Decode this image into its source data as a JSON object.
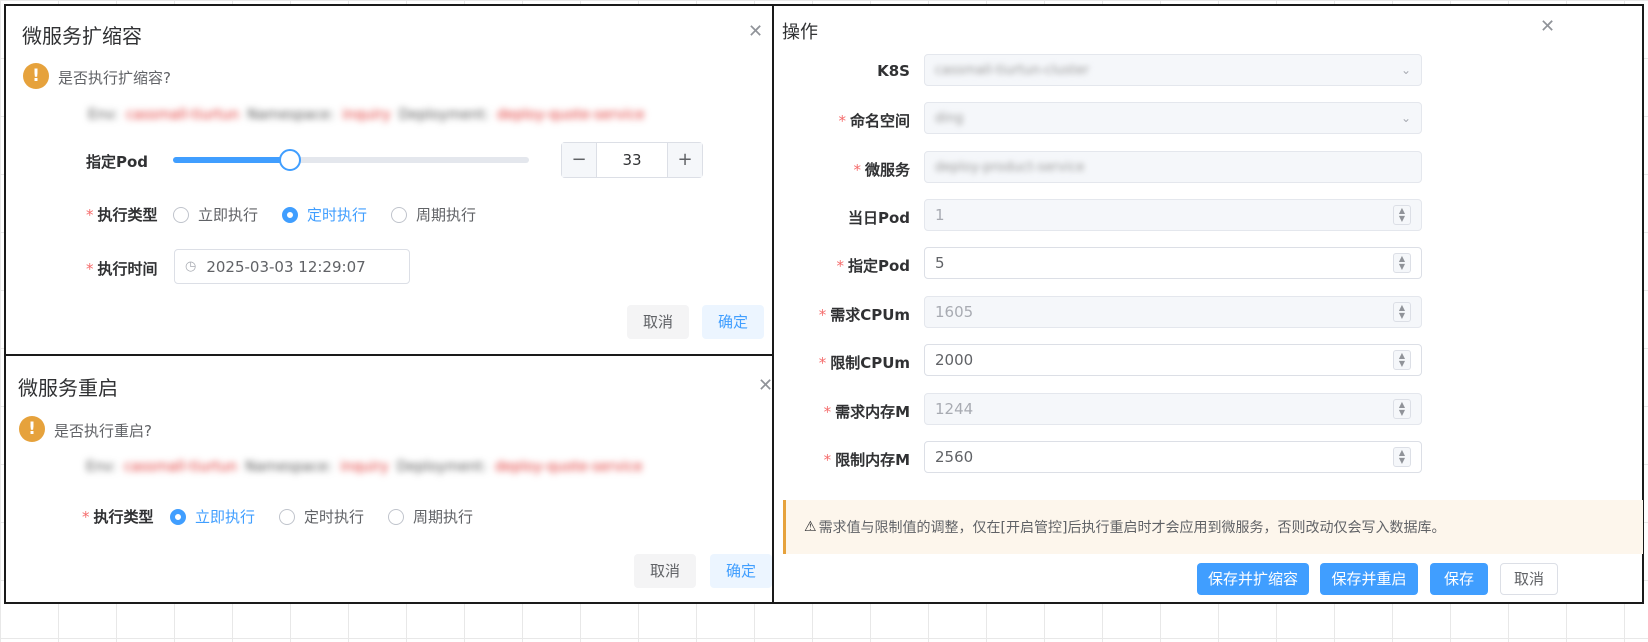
{
  "scale_dialog": {
    "title": "微服务扩缩容",
    "question": "是否执行扩缩容?",
    "info": [
      {
        "key": "Env:",
        "value": "cassmall-tiurtun"
      },
      {
        "key": "Namespace:",
        "value": "inquiry"
      },
      {
        "key": "Deployment:",
        "value": "deploy-quote-service"
      }
    ],
    "pod_label": "指定Pod",
    "pod_value": "33",
    "slider_fraction": 0.33,
    "exec_type_label": "执行类型",
    "exec_options": [
      "立即执行",
      "定时执行",
      "周期执行"
    ],
    "exec_selected": "定时执行",
    "exec_time_label": "执行时间",
    "exec_time_value": "2025-03-03 12:29:07",
    "cancel_label": "取消",
    "confirm_label": "确定"
  },
  "restart_dialog": {
    "title": "微服务重启",
    "question": "是否执行重启?",
    "info": [
      {
        "key": "Env:",
        "value": "cassmall-tiurtun"
      },
      {
        "key": "Namespace:",
        "value": "inquiry"
      },
      {
        "key": "Deployment:",
        "value": "deploy-quote-service"
      }
    ],
    "exec_type_label": "执行类型",
    "exec_options": [
      "立即执行",
      "定时执行",
      "周期执行"
    ],
    "exec_selected": "立即执行",
    "cancel_label": "取消",
    "confirm_label": "确定"
  },
  "ops_dialog": {
    "title": "操作",
    "fields": {
      "k8s": {
        "label": "K8S",
        "value": "cassmall-tiurtun-cluster"
      },
      "namespace": {
        "label": "命名空间",
        "value": "ding"
      },
      "service": {
        "label": "微服务",
        "value": "deploy-product-service"
      },
      "current_pod": {
        "label": "当日Pod",
        "value": "1"
      },
      "target_pod": {
        "label": "指定Pod",
        "value": "5"
      },
      "req_cpu": {
        "label": "需求CPUm",
        "value": "1605"
      },
      "limit_cpu": {
        "label": "限制CPUm",
        "value": "2000"
      },
      "req_mem": {
        "label": "需求内存M",
        "value": "1244"
      },
      "limit_mem": {
        "label": "限制内存M",
        "value": "2560"
      }
    },
    "alert": "需求值与限制值的调整，仅在[开启管控]后执行重启时才会应用到微服务，否则改动仅会写入数据库。",
    "buttons": {
      "save_scale": "保存并扩缩容",
      "save_restart": "保存并重启",
      "save": "保存",
      "cancel": "取消"
    }
  },
  "colors": {
    "primary": "#409eff",
    "warning": "#e6a23c",
    "danger": "#f56c6c"
  }
}
